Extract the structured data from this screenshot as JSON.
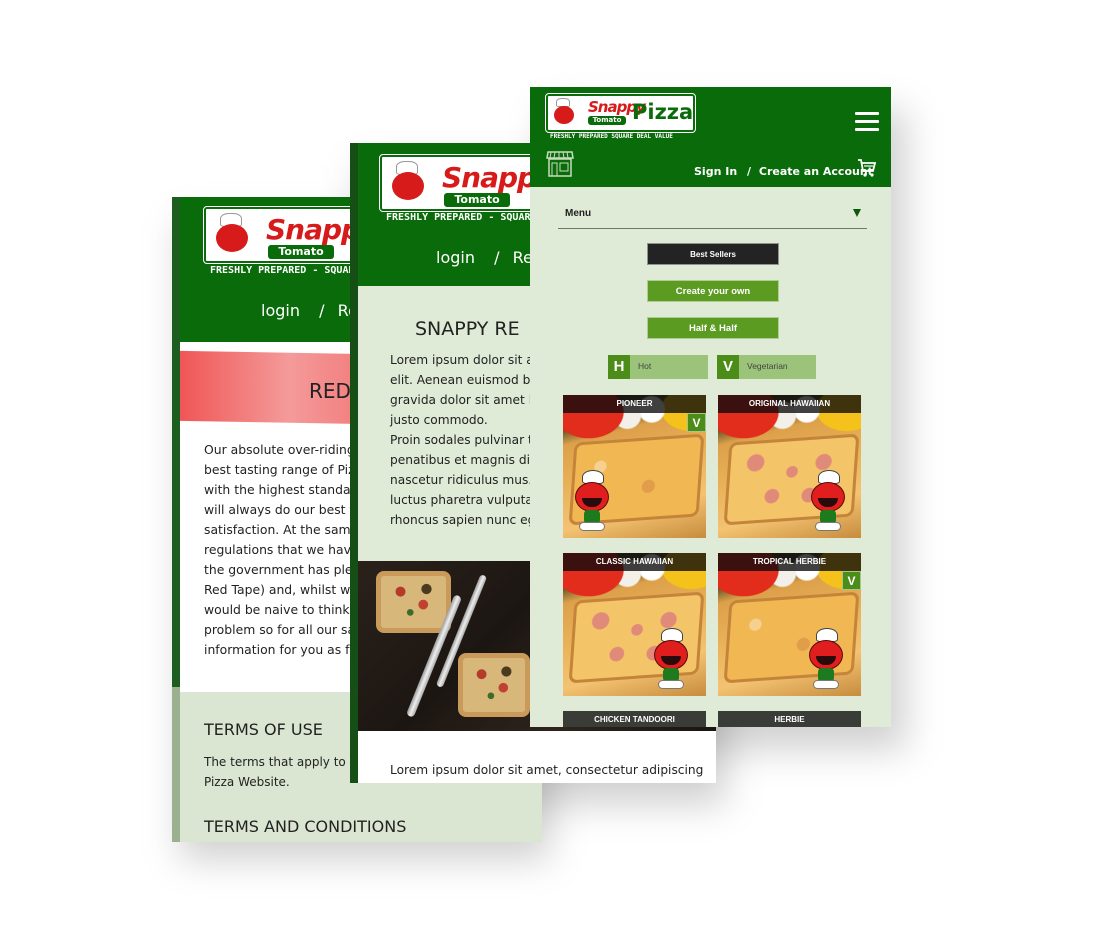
{
  "brand": {
    "snappy": "Snappy",
    "tomato": "Tomato",
    "pizza": "Pizza",
    "tagline_short": "FRESHLY PREPARED - SQUARE",
    "tagline_full": "FRESHLY PREPARED SQUARE DEAL VALUE",
    "colors": {
      "header_green": "#0a6b0a",
      "button_green": "#5b9b22",
      "badge_green": "#4c8c18",
      "page_bg": "#dfead7",
      "dark_button": "#232323"
    }
  },
  "back_screen": {
    "auth": {
      "login": "login",
      "separator": "/",
      "register": "Re"
    },
    "banner_title": "RED",
    "body_lines": [
      "Our absolute over-riding p",
      "best tasting range of Pizza",
      "with the highest standards",
      "will always do our best to",
      "satisfaction. At the same ti",
      "regulations that we have t",
      "the government has pledg",
      "Red Tape) and, whilst we w",
      "would be naive to think th",
      "problem so for all our sake",
      "information for you as foll"
    ],
    "terms_of_use_heading": "TERMS OF USE",
    "terms_of_use_text_lines": [
      "The terms that apply to yo",
      "Pizza Website."
    ],
    "terms_conditions_heading": "TERMS AND CONDITIONS"
  },
  "middle_screen": {
    "auth": {
      "login": "login",
      "separator": "/",
      "register": "Reg"
    },
    "title": "SNAPPY RE",
    "body_lines": [
      "Lorem ipsum dolor sit am",
      "elit. Aenean euismod bib",
      "gravida dolor sit amet lac",
      "justo commodo.",
      "Proin sodales pulvinar te",
      "penatibus et magnis dis p",
      "nascetur ridiculus mus. N",
      "luctus pharetra vulputate",
      "rhoncus sapien nunc ege"
    ],
    "lower_text": "Lorem ipsum dolor sit amet, consectetur adipiscing"
  },
  "front_screen": {
    "auth": {
      "sign_in": "Sign In",
      "separator": "/",
      "create_account": "Create an Account"
    },
    "icons": {
      "menu": "hamburger-icon",
      "store": "store-icon",
      "cart": "cart-icon"
    },
    "menu_select": {
      "selected": "Menu"
    },
    "category_buttons": [
      {
        "label": "Best Sellers",
        "style": "dark"
      },
      {
        "label": "Create your own",
        "style": "green"
      },
      {
        "label": "Half & Half",
        "style": "green"
      }
    ],
    "legend": [
      {
        "badge": "H",
        "label": "Hot"
      },
      {
        "badge": "V",
        "label": "Vegetarian"
      }
    ],
    "pizzas": [
      {
        "name": "PIONEER",
        "badge": "V"
      },
      {
        "name": "ORIGINAL HAWAIIAN",
        "badge": ""
      },
      {
        "name": "CLASSIC HAWAIIAN",
        "badge": ""
      },
      {
        "name": "TROPICAL HERBIE",
        "badge": "V"
      },
      {
        "name": "CHICKEN TANDOORI",
        "badge": ""
      },
      {
        "name": "HERBIE",
        "badge": ""
      }
    ]
  }
}
